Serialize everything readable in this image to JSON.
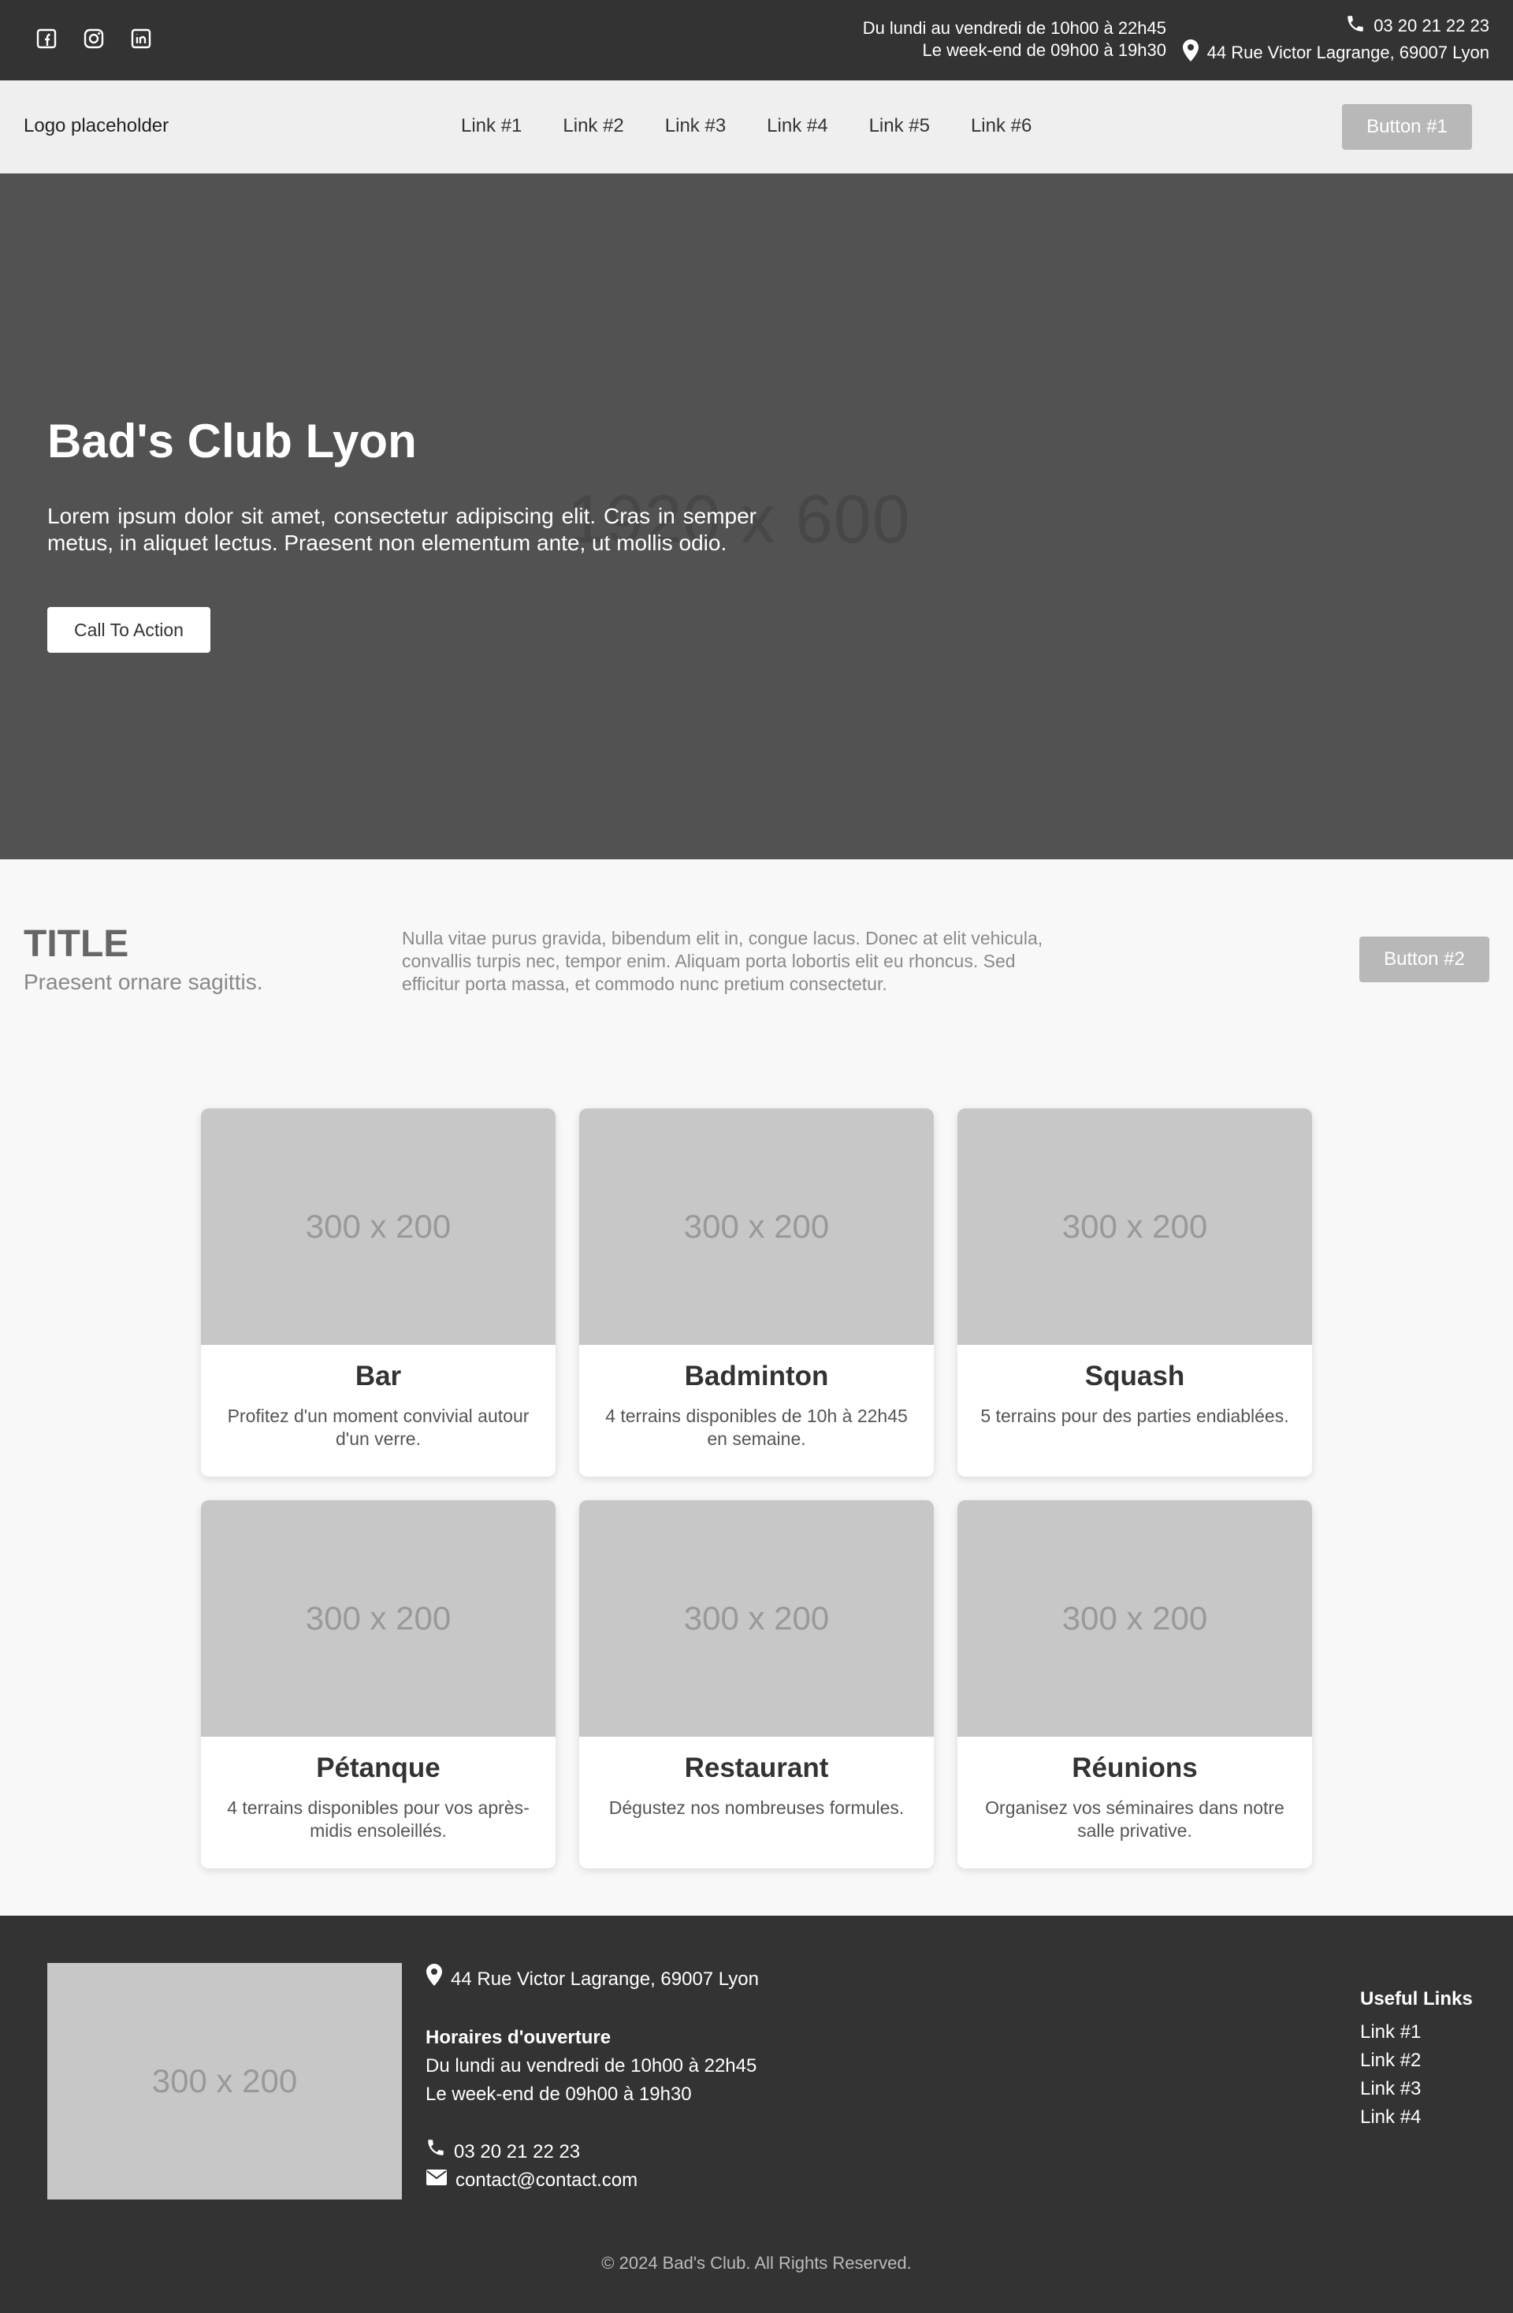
{
  "topbar": {
    "social": [
      "facebook-icon",
      "instagram-icon",
      "linkedin-icon"
    ],
    "hours_weekday": "Du lundi au vendredi de 10h00 à 22h45",
    "hours_weekend": "Le week-end de 09h00 à 19h30",
    "phone": "03 20 21 22 23",
    "address": "44 Rue Victor Lagrange, 69007 Lyon"
  },
  "nav": {
    "logo": "Logo placeholder",
    "links": [
      "Link #1",
      "Link #2",
      "Link #3",
      "Link #4",
      "Link #5",
      "Link #6"
    ],
    "button": "Button #1"
  },
  "hero": {
    "placeholder": "1920 x 600",
    "title": "Bad's Club Lyon",
    "text": "Lorem ipsum dolor sit amet, consectetur adipiscing elit. Cras in semper metus, in aliquet lectus. Praesent non elementum ante, ut mollis odio.",
    "cta": "Call To Action"
  },
  "section": {
    "title": "TITLE",
    "subtitle": "Praesent ornare sagittis.",
    "text": "Nulla vitae purus gravida, bibendum elit in, congue lacus. Donec at elit vehicula, convallis turpis nec, tempor enim. Aliquam porta lobortis elit eu rhoncus. Sed efficitur porta massa, et commodo nunc pretium consectetur.",
    "button": "Button #2"
  },
  "cards": [
    {
      "image": "300 x 200",
      "title": "Bar",
      "text": "Profitez d'un moment convivial autour d'un verre."
    },
    {
      "image": "300 x 200",
      "title": "Badminton",
      "text": "4 terrains disponibles de 10h à 22h45 en semaine."
    },
    {
      "image": "300 x 200",
      "title": "Squash",
      "text": "5 terrains pour des parties endiablées."
    },
    {
      "image": "300 x 200",
      "title": "Pétanque",
      "text": "4 terrains disponibles pour vos après-midis ensoleillés."
    },
    {
      "image": "300 x 200",
      "title": "Restaurant",
      "text": "Dégustez nos nombreuses formules."
    },
    {
      "image": "300 x 200",
      "title": "Réunions",
      "text": "Organisez vos séminaires dans notre salle privative."
    }
  ],
  "footer": {
    "image": "300 x 200",
    "address": "44 Rue Victor Lagrange, 69007 Lyon",
    "hours_title": "Horaires d'ouverture",
    "hours_weekday": "Du lundi au vendredi de 10h00 à 22h45",
    "hours_weekend": "Le week-end de 09h00 à 19h30",
    "phone": "03 20 21 22 23",
    "email": "contact@contact.com",
    "useful_title": "Useful Links",
    "useful_links": [
      "Link #1",
      "Link #2",
      "Link #3",
      "Link #4"
    ],
    "copyright": "© 2024 Bad's Club. All Rights Reserved."
  }
}
